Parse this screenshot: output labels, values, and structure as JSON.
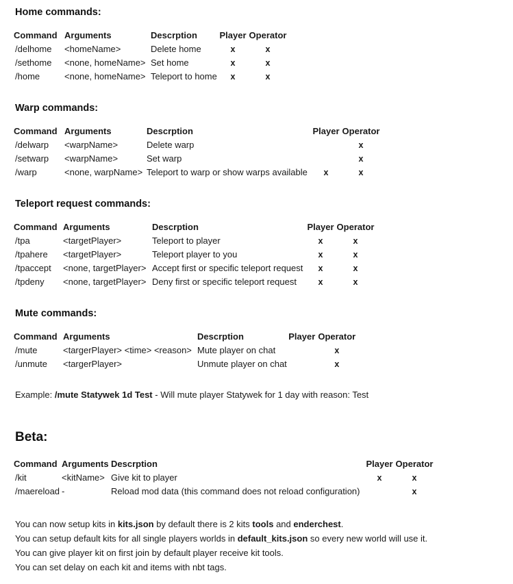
{
  "document": {
    "background_color": "#ffffff",
    "text_color": "#1a1a1a"
  },
  "common_headers": {
    "command": "Command",
    "arguments": "Arguments",
    "description": "Descrption",
    "player": "Player",
    "operator": "Operator",
    "mark": "x"
  },
  "sections": [
    {
      "id": "home",
      "heading": "Home commands:",
      "rows": [
        {
          "command": "/delhome",
          "arguments": "<homeName>",
          "description": "Delete home",
          "player": "x",
          "operator": "x"
        },
        {
          "command": "/sethome",
          "arguments": "<none, homeName>",
          "description": "Set home",
          "player": "x",
          "operator": "x"
        },
        {
          "command": "/home",
          "arguments": "<none, homeName>",
          "description": "Teleport to home",
          "player": "x",
          "operator": "x"
        }
      ]
    },
    {
      "id": "warp",
      "heading": "Warp commands:",
      "rows": [
        {
          "command": "/delwarp",
          "arguments": "<warpName>",
          "description": "Delete warp",
          "player": "",
          "operator": "x"
        },
        {
          "command": "/setwarp",
          "arguments": "<warpName>",
          "description": "Set warp",
          "player": "",
          "operator": "x"
        },
        {
          "command": "/warp",
          "arguments": "<none, warpName>",
          "description": "Teleport to warp or show warps available",
          "player": "x",
          "operator": "x"
        }
      ]
    },
    {
      "id": "teleport",
      "heading": "Teleport request commands:",
      "rows": [
        {
          "command": "/tpa",
          "arguments": "<targetPlayer>",
          "description": "Teleport to player",
          "player": "x",
          "operator": "x"
        },
        {
          "command": "/tpahere",
          "arguments": "<targetPlayer>",
          "description": "Teleport player to you",
          "player": "x",
          "operator": "x"
        },
        {
          "command": "/tpaccept",
          "arguments": "<none, targetPlayer>",
          "description": "Accept first or specific teleport request",
          "player": "x",
          "operator": "x"
        },
        {
          "command": "/tpdeny",
          "arguments": "<none, targetPlayer>",
          "description": "Deny first or specific teleport request",
          "player": "x",
          "operator": "x"
        }
      ]
    },
    {
      "id": "mute",
      "heading": "Mute commands:",
      "rows": [
        {
          "command": "/mute",
          "arguments": "<targerPlayer> <time> <reason>",
          "description": "Mute player on chat",
          "player": "",
          "operator": "x"
        },
        {
          "command": "/unmute",
          "arguments": "<targerPlayer>",
          "description": "Unmute player on chat",
          "player": "",
          "operator": "x"
        }
      ]
    },
    {
      "id": "beta",
      "heading": "Beta:",
      "rows": [
        {
          "command": "/kit",
          "arguments": "<kitName>",
          "description": "Give kit to player",
          "player": "x",
          "operator": "x"
        },
        {
          "command": "/maereload",
          "arguments": "-",
          "description": "Reload mod data (this command does not reload configuration)",
          "player": "",
          "operator": "x"
        }
      ]
    }
  ],
  "example": {
    "label": "Example:",
    "command": "/mute Statywek 1d Test",
    "separator": "-",
    "explanation": "Will mute player Statywek for 1 day with reason: Test"
  },
  "notes": [
    {
      "parts": [
        {
          "text": "You can now setup kits in ",
          "bold": false
        },
        {
          "text": "kits.json",
          "bold": true
        },
        {
          "text": " by default there is 2 kits ",
          "bold": false
        },
        {
          "text": "tools",
          "bold": true
        },
        {
          "text": " and ",
          "bold": false
        },
        {
          "text": "enderchest",
          "bold": true
        },
        {
          "text": ".",
          "bold": false
        }
      ]
    },
    {
      "parts": [
        {
          "text": "You can setup default kits for all single players worlds in ",
          "bold": false
        },
        {
          "text": "default_kits.json",
          "bold": true
        },
        {
          "text": " so every new world will use it.",
          "bold": false
        }
      ]
    },
    {
      "parts": [
        {
          "text": "You can give player kit on first join by default player receive kit tools.",
          "bold": false
        }
      ]
    },
    {
      "parts": [
        {
          "text": "You can set delay on each kit and items with nbt tags.",
          "bold": false
        }
      ]
    }
  ]
}
